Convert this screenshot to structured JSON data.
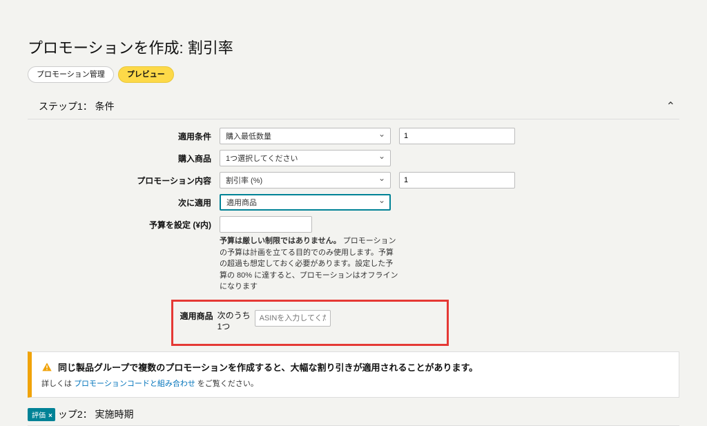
{
  "page": {
    "title": "プロモーションを作成: 割引率"
  },
  "pills": {
    "manage": "プロモーション管理",
    "preview": "プレビュー"
  },
  "step1": {
    "header": "ステップ1： 条件",
    "rows": {
      "condition": {
        "label": "適用条件",
        "select": "購入最低数量",
        "value": "1"
      },
      "product": {
        "label": "購入商品",
        "select": "1つ選択してください"
      },
      "content": {
        "label": "プロモーション内容",
        "select": "割引率 (%)",
        "value": "1"
      },
      "apply": {
        "label": "次に適用",
        "select": "適用商品"
      },
      "budget": {
        "label": "予算を設定 (¥内)",
        "value": "",
        "note_strong": "予算は厳しい制限ではありません。",
        "note_rest": "プロモーションの予算は計画を立てる目的でのみ使用します。予算の超過も想定しておく必要があります。設定した予算の 80% に達すると、プロモーションはオフラインになります"
      }
    },
    "asin": {
      "label": "適用商品",
      "mid": "次のうち1つ",
      "placeholder": "ASINを入力してくだ"
    }
  },
  "alert": {
    "title": "同じ製品グループで複数のプロモーションを作成すると、大幅な割り引きが適用されることがあります。",
    "sub_prefix": "詳しくは ",
    "sub_link": "プロモーションコードと組み合わせ",
    "sub_suffix": " をご覧ください。"
  },
  "step2": {
    "badge_label": "評価",
    "badge_x": "×",
    "header": "ップ2： 実施時期"
  }
}
